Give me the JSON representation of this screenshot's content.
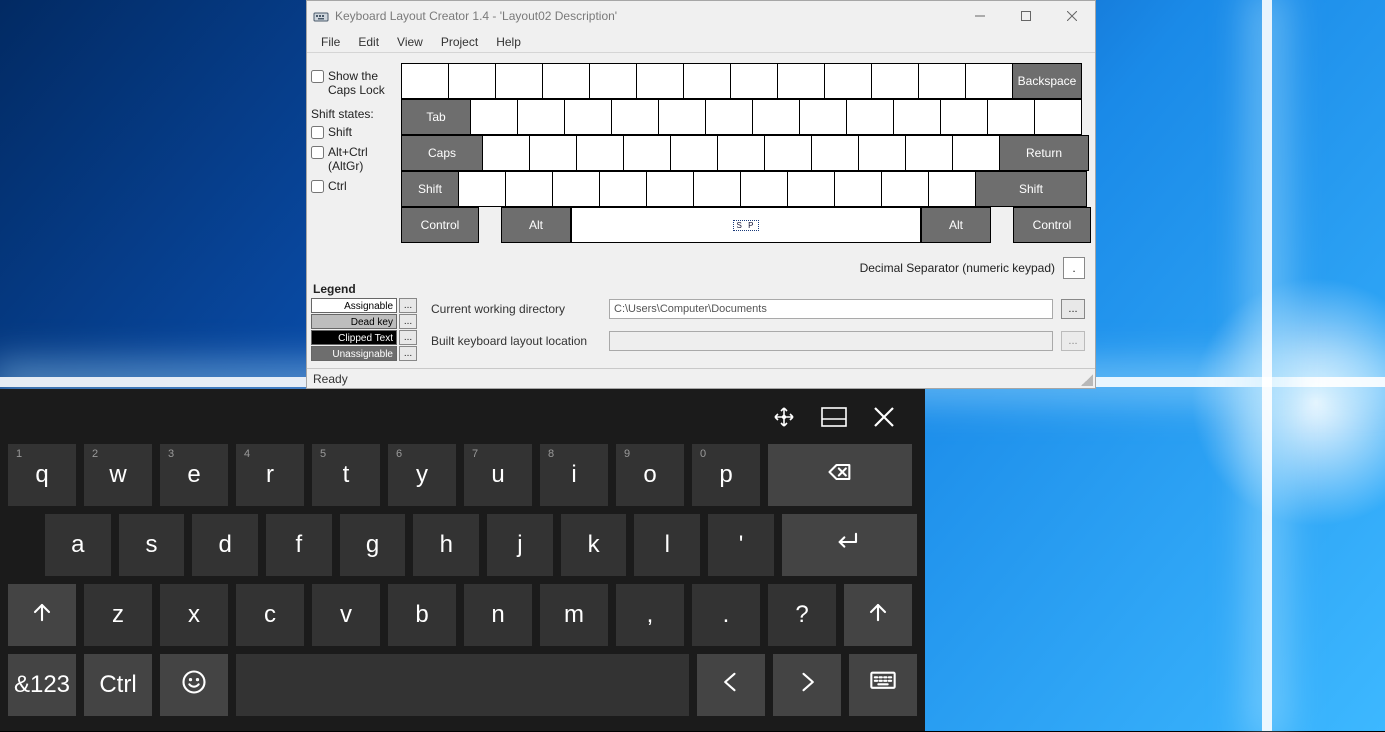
{
  "klc": {
    "title": "Keyboard Layout Creator 1.4 - 'Layout02 Description'",
    "menu": [
      "File",
      "Edit",
      "View",
      "Project",
      "Help"
    ],
    "left": {
      "show_caps": "Show the Caps Lock",
      "shift_states_hdr": "Shift states:",
      "shift": "Shift",
      "altgr": "Alt+Ctrl (AltGr)",
      "ctrl": "Ctrl"
    },
    "keys": {
      "backspace": "Backspace",
      "tab": "Tab",
      "caps": "Caps",
      "return": "Return",
      "shift_l": "Shift",
      "shift_r": "Shift",
      "ctrl_l": "Control",
      "alt_l": "Alt",
      "alt_r": "Alt",
      "ctrl_r": "Control",
      "sp": "S P"
    },
    "decimal_label": "Decimal Separator (numeric keypad)",
    "decimal_value": ".",
    "legend_title": "Legend",
    "legend": [
      {
        "label": "Assignable",
        "bg": "#ffffff",
        "fg": "#000"
      },
      {
        "label": "Dead key",
        "bg": "#bdbdbd",
        "fg": "#000"
      },
      {
        "label": "Clipped Text",
        "bg": "#000000",
        "fg": "#fff"
      },
      {
        "label": "Unassignable",
        "bg": "#6e6e6e",
        "fg": "#fff"
      }
    ],
    "paths": {
      "cwd_label": "Current working directory",
      "cwd_value": "C:\\Users\\Computer\\Documents",
      "built_label": "Built keyboard layout location",
      "built_value": ""
    },
    "status": "Ready"
  },
  "osk": {
    "row1_hints": [
      "1",
      "2",
      "3",
      "4",
      "5",
      "6",
      "7",
      "8",
      "9",
      "0"
    ],
    "row1": [
      "q",
      "w",
      "e",
      "r",
      "t",
      "y",
      "u",
      "i",
      "o",
      "p"
    ],
    "row2": [
      "a",
      "s",
      "d",
      "f",
      "g",
      "h",
      "j",
      "k",
      "l",
      "'"
    ],
    "row3": [
      "z",
      "x",
      "c",
      "v",
      "b",
      "n",
      "m",
      ",",
      ".",
      "?"
    ],
    "numsym": "&123",
    "ctrl": "Ctrl"
  }
}
